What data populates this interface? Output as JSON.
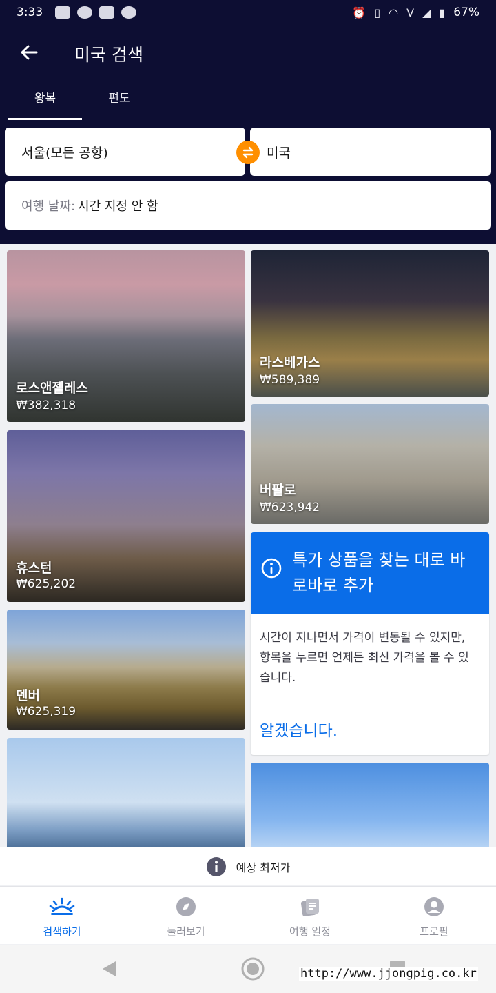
{
  "status_bar": {
    "time": "3:33",
    "battery": "67%"
  },
  "header": {
    "title": "미국 검색"
  },
  "tabs": [
    {
      "label": "왕복"
    },
    {
      "label": "편도"
    }
  ],
  "search": {
    "origin": "서울(모든 공항)",
    "destination": "미국",
    "date_label": "여행 날짜:",
    "date_value": "시간 지정 안 함"
  },
  "destinations": [
    {
      "city": "로스앤젤레스",
      "price": "₩382,318"
    },
    {
      "city": "라스베가스",
      "price": "₩589,389"
    },
    {
      "city": "휴스턴",
      "price": "₩625,202"
    },
    {
      "city": "버팔로",
      "price": "₩623,942"
    },
    {
      "city": "덴버",
      "price": "₩625,319"
    }
  ],
  "info_card": {
    "title": "특가 상품을 찾는 대로 바로바로 추가",
    "body": "시간이 지나면서 가격이 변동될 수 있지만, 항목을 누르면 언제든 최신 가격을 볼 수 있습니다.",
    "confirm": "알겠습니다."
  },
  "estimate_bar": {
    "label": "예상 최저가"
  },
  "bottom_nav": [
    {
      "label": "검색하기",
      "icon": "sunrise-icon"
    },
    {
      "label": "둘러보기",
      "icon": "compass-icon"
    },
    {
      "label": "여행 일정",
      "icon": "trips-icon"
    },
    {
      "label": "프로필",
      "icon": "profile-icon"
    }
  ],
  "watermark": "http://www.jjongpig.co.kr",
  "colors": {
    "header_bg": "#0d0e33",
    "accent_blue": "#0a6de8",
    "swap_orange": "#ff8f00"
  }
}
